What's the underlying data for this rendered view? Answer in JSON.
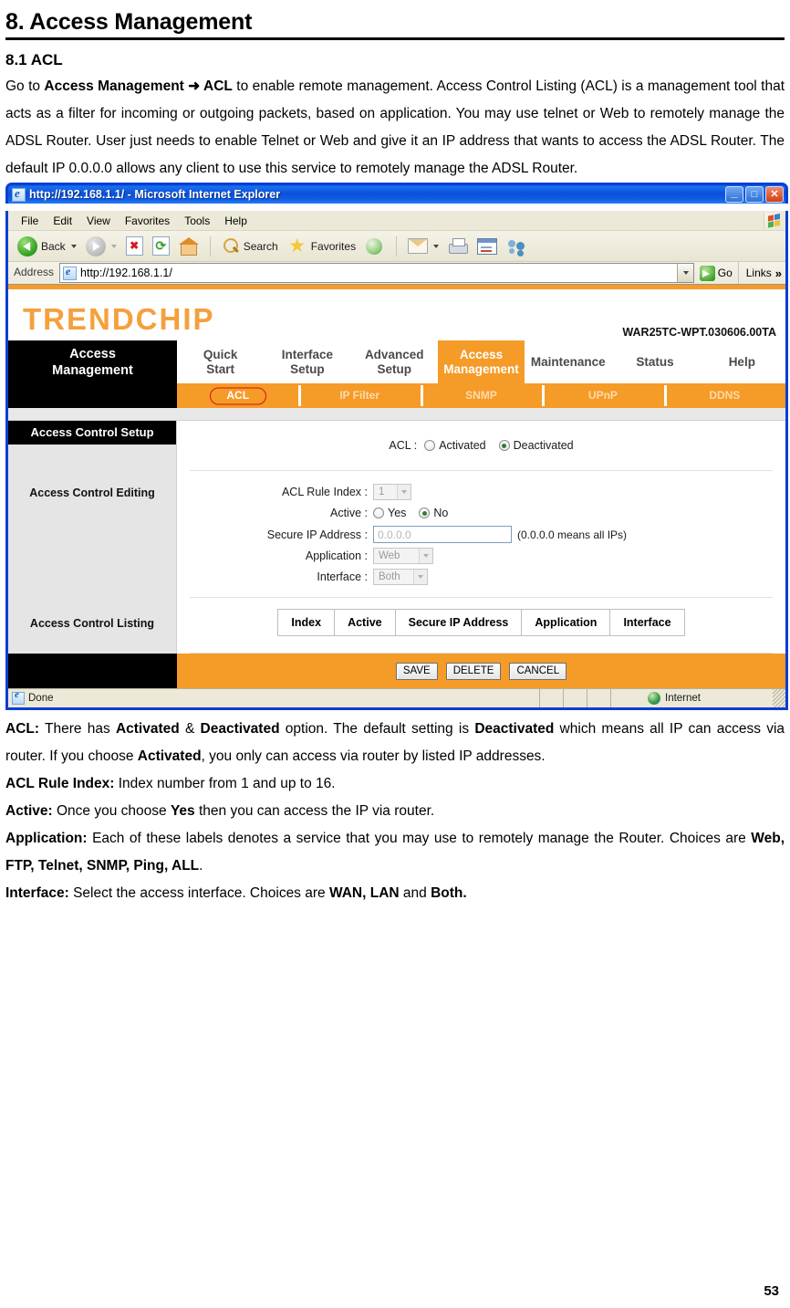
{
  "document": {
    "title": "8. Access Management",
    "section_title": "8.1 ACL",
    "intro": {
      "p1_a": "Go to ",
      "p1_b": "Access Management",
      "p1_c": " ➜ ",
      "p1_d": "ACL",
      "p1_e": " to enable remote management. Access Control Listing (ACL) is a management tool that acts as a filter for incoming or outgoing packets, based on application. You may use telnet or Web to remotely manage the ADSL Router. User just needs to enable Telnet or Web and give it an IP address that wants to access the ADSL Router. The default IP 0.0.0.0 allows any client to use this service to remotely manage the ADSL Router."
    },
    "notes": {
      "acl_label": "ACL:",
      "acl_t1": " There has ",
      "acl_b1": "Activated",
      "acl_t2": " & ",
      "acl_b2": "Deactivated",
      "acl_t3": " option. The default setting is ",
      "acl_b3": "Deactivated",
      "acl_t4": " which means all IP can access via router. If you choose ",
      "acl_b4": "Activated",
      "acl_t5": ", you only can access via router by listed IP addresses.",
      "rule_label": "ACL Rule Index:",
      "rule_text": " Index number from 1 and up to 16.",
      "active_label": "Active:",
      "active_t1": " Once you choose ",
      "active_b1": "Yes",
      "active_t2": " then you can access the IP via router.",
      "app_label": "Application:",
      "app_t1": " Each of these labels denotes a service that you may use to remotely manage the Router. Choices are ",
      "app_b1": "Web, FTP, Telnet, SNMP, Ping, ALL",
      "app_t2": ".",
      "iface_label": "Interface:",
      "iface_t1": " Select the access interface. Choices are ",
      "iface_b1": "WAN, LAN",
      "iface_t2": " and ",
      "iface_b2": "Both.",
      "iface_t3": ""
    },
    "page_number": "53"
  },
  "browser": {
    "title": "http://192.168.1.1/ - Microsoft Internet Explorer",
    "window_buttons": {
      "minimize": "_",
      "maximize": "□",
      "close": "✕"
    },
    "menu": [
      {
        "label": "File",
        "accel": "F"
      },
      {
        "label": "Edit",
        "accel": "E"
      },
      {
        "label": "View",
        "accel": "V"
      },
      {
        "label": "Favorites",
        "accel": "a"
      },
      {
        "label": "Tools",
        "accel": "T"
      },
      {
        "label": "Help",
        "accel": "H"
      }
    ],
    "toolbar": {
      "back": "Back",
      "forward": "",
      "stop": "",
      "refresh": "",
      "home": "",
      "search": "Search",
      "favorites": "Favorites",
      "history": "",
      "mail": "",
      "print": "",
      "edit": "",
      "messenger": ""
    },
    "address": {
      "label": "Address",
      "value": "http://192.168.1.1/",
      "go_label": "Go",
      "links_label": "Links",
      "chevron": "»"
    },
    "status": {
      "text": "Done",
      "zone": "Internet"
    }
  },
  "router": {
    "brand": "TRENDCHIP",
    "model": "WAR25TC-WPT.030606.00TA",
    "current_section": "Access\nManagement",
    "current_section_line1": "Access",
    "current_section_line2": "Management",
    "nav_tabs": [
      {
        "line1": "Quick",
        "line2": "Start",
        "active": false
      },
      {
        "line1": "Interface",
        "line2": "Setup",
        "active": false
      },
      {
        "line1": "Advanced",
        "line2": "Setup",
        "active": false
      },
      {
        "line1": "Access",
        "line2": "Management",
        "active": true
      },
      {
        "line1": "Maintenance",
        "line2": "",
        "active": false
      },
      {
        "line1": "Status",
        "line2": "",
        "active": false
      },
      {
        "line1": "Help",
        "line2": "",
        "active": false
      }
    ],
    "sub_tabs": [
      {
        "label": "ACL",
        "selected": true
      },
      {
        "label": "IP Filter",
        "selected": false
      },
      {
        "label": "SNMP",
        "selected": false
      },
      {
        "label": "UPnP",
        "selected": false
      },
      {
        "label": "DDNS",
        "selected": false
      }
    ],
    "sidebar": {
      "header": "Access Control Setup",
      "editing": "Access Control Editing",
      "listing": "Access Control Listing"
    },
    "form": {
      "acl_label": "ACL :",
      "acl_option_activated": "Activated",
      "acl_option_deactivated": "Deactivated",
      "acl_selected": "Deactivated",
      "rule_index_label": "ACL Rule Index :",
      "rule_index_value": "1",
      "active_label": "Active :",
      "active_option_yes": "Yes",
      "active_option_no": "No",
      "active_selected": "No",
      "secure_ip_label": "Secure IP Address :",
      "secure_ip_value": "0.0.0.0",
      "secure_ip_hint": "(0.0.0.0 means all IPs)",
      "application_label": "Application :",
      "application_value": "Web",
      "interface_label": "Interface :",
      "interface_value": "Both"
    },
    "table": {
      "headers": [
        "Index",
        "Active",
        "Secure IP Address",
        "Application",
        "Interface"
      ],
      "rows": []
    },
    "buttons": {
      "save": "SAVE",
      "delete": "DELETE",
      "cancel": "CANCEL"
    },
    "colors": {
      "accent_orange": "#f59b28",
      "brand_orange": "#f5a03c",
      "sidebar_grey": "#e5e5e5",
      "highlight_red": "#d81010"
    }
  }
}
